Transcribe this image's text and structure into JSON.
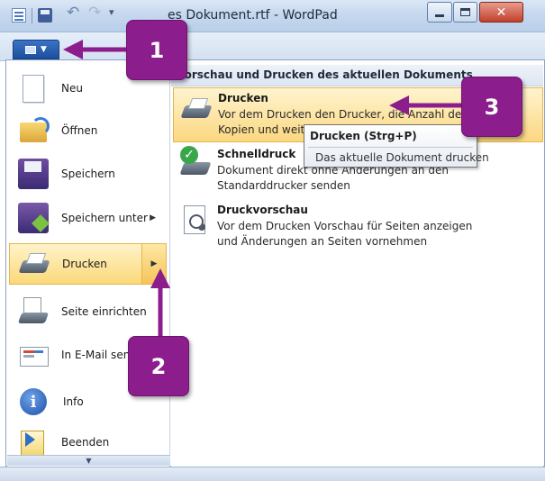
{
  "window": {
    "title": "es Dokument.rtf - WordPad",
    "minimize_icon": "minimize-icon",
    "maximize_icon": "maximize-icon",
    "close_icon": "close-icon"
  },
  "quick_access": {
    "undo_glyph": "↶",
    "redo_glyph": "↷",
    "customize_glyph": "▾"
  },
  "app_menu": {
    "button_glyph": "▼",
    "items": [
      {
        "label": "Neu",
        "icon": "new-document-icon"
      },
      {
        "label": "Öffnen",
        "icon": "open-folder-icon"
      },
      {
        "label": "Speichern",
        "icon": "save-disk-icon"
      },
      {
        "label": "Speichern unter",
        "icon": "save-as-icon",
        "submenu_mark": "▶"
      },
      {
        "label": "Drucken",
        "icon": "printer-icon",
        "submenu_mark": "▶"
      },
      {
        "label": "Seite einrichten",
        "icon": "page-setup-icon"
      },
      {
        "label": "In E-Mail senden",
        "icon": "email-icon"
      },
      {
        "label": "Info",
        "icon": "info-icon"
      },
      {
        "label": "Beenden",
        "icon": "exit-icon"
      }
    ],
    "scroll_glyph": "▼"
  },
  "print_panel": {
    "header": "Vorschau und Drucken des aktuellen Dokuments",
    "options": [
      {
        "title": "Drucken",
        "description": "Vor dem Drucken den Drucker, die Anzahl der Kopien und weitere Druckoptionen auswählen",
        "icon": "printer-icon"
      },
      {
        "title": "Schnelldruck",
        "description": "Dokument direkt ohne Änderungen an den Standarddrucker senden",
        "icon": "quick-print-icon"
      },
      {
        "title": "Druckvorschau",
        "description": "Vor dem Drucken Vorschau für Seiten anzeigen und Änderungen an Seiten vornehmen",
        "icon": "print-preview-icon"
      }
    ]
  },
  "tooltip": {
    "title": "Drucken (Strg+P)",
    "body": "Das aktuelle Dokument drucken"
  },
  "callouts": [
    "1",
    "2",
    "3"
  ],
  "colors": {
    "callout": "#8c1d8d",
    "highlight": "#fbd97a",
    "app_button": "#1c4f9d"
  }
}
